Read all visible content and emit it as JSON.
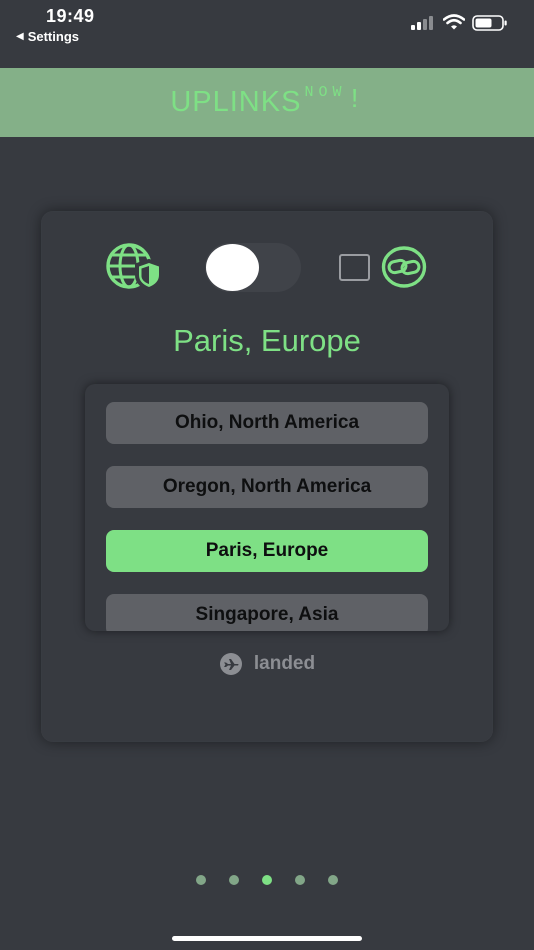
{
  "status_bar": {
    "time": "19:49",
    "back_label": "Settings"
  },
  "header": {
    "brand_main": "UPLINKS",
    "brand_superscript": "NOW",
    "brand_suffix": "!"
  },
  "card": {
    "toggle_on": false,
    "checkbox_checked": false,
    "selected_region": "Paris, Europe",
    "regions": [
      {
        "label": "Ohio, North America",
        "selected": false
      },
      {
        "label": "Oregon, North America",
        "selected": false
      },
      {
        "label": "Paris, Europe",
        "selected": true
      },
      {
        "label": "Singapore, Asia",
        "selected": false
      }
    ],
    "status_text": "landed"
  },
  "pagination": {
    "total": 5,
    "current": 3
  },
  "colors": {
    "accent": "#7ee085",
    "banner": "#84b088",
    "background": "#373a40",
    "button": "#5f6166"
  },
  "icons": [
    "back-arrow-icon",
    "signal-icon",
    "wifi-icon",
    "battery-icon",
    "globe-shield-icon",
    "link-icon",
    "plane-icon"
  ]
}
